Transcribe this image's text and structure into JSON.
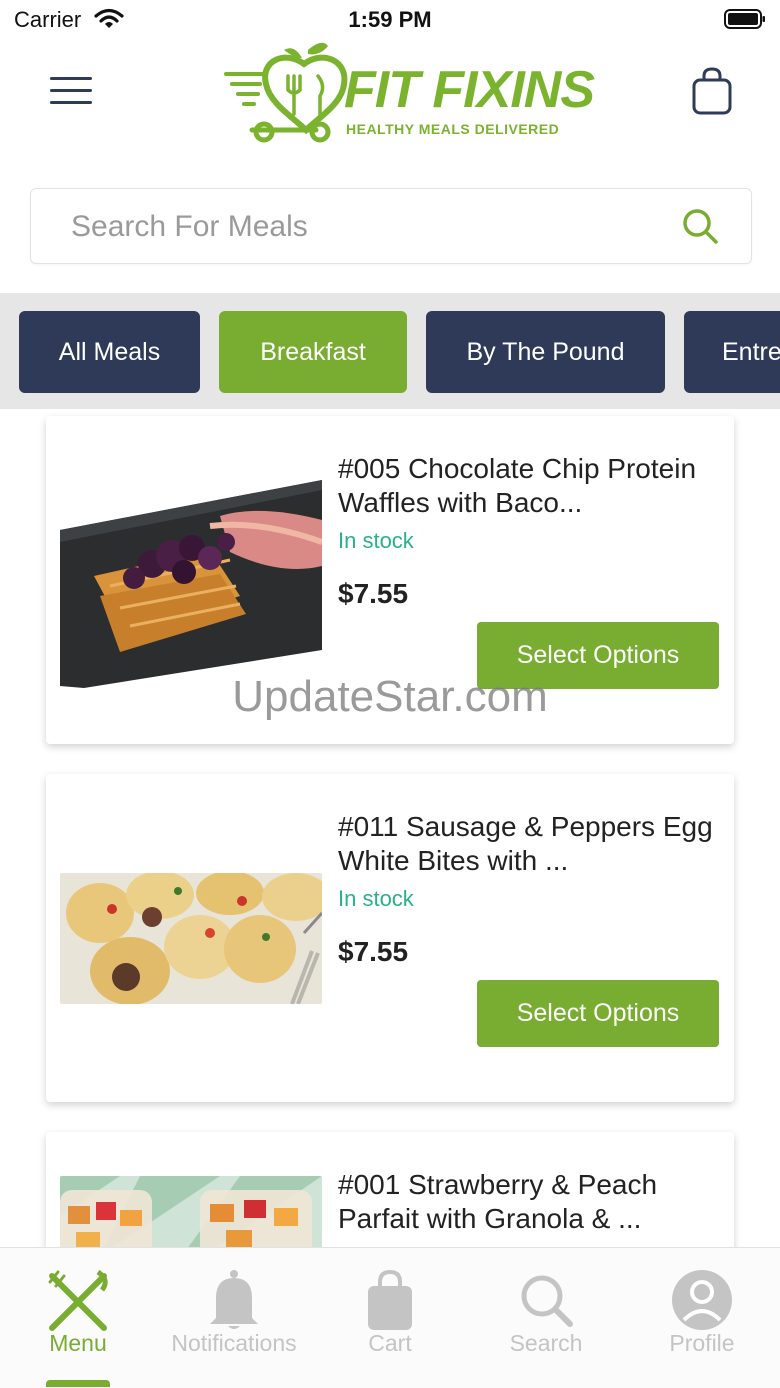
{
  "status_bar": {
    "carrier": "Carrier",
    "time": "1:59 PM"
  },
  "header": {
    "logo_title": "FIT FIXINS",
    "logo_subtitle": "HEALTHY MEALS DELIVERED",
    "brand_color": "#7bb32e"
  },
  "search": {
    "placeholder": "Search For Meals"
  },
  "categories": [
    {
      "label": "All Meals",
      "active": false
    },
    {
      "label": "Breakfast",
      "active": true
    },
    {
      "label": "By The Pound",
      "active": false
    },
    {
      "label": "Entre",
      "active": false
    }
  ],
  "products": [
    {
      "title": "#005  Chocolate Chip Protein Waffles with Baco...",
      "stock": "In stock",
      "price": "$7.55",
      "button": "Select Options",
      "image": "waffles-with-berries-and-bacon"
    },
    {
      "title": "#011  Sausage & Peppers Egg White Bites with ...",
      "stock": "In stock",
      "price": "$7.55",
      "button": "Select Options",
      "image": "egg-white-bites"
    },
    {
      "title": "#001 Strawberry & Peach Parfait with Granola & ...",
      "stock": "",
      "price": "",
      "button": "",
      "image": "fruit-parfait-cups"
    }
  ],
  "watermark": "UpdateStar.com",
  "tabbar": {
    "items": [
      {
        "label": "Menu",
        "icon": "fork-knife-icon",
        "active": true
      },
      {
        "label": "Notifications",
        "icon": "bell-icon",
        "active": false
      },
      {
        "label": "Cart",
        "icon": "bag-icon",
        "active": false
      },
      {
        "label": "Search",
        "icon": "search-icon",
        "active": false
      },
      {
        "label": "Profile",
        "icon": "profile-icon",
        "active": false
      }
    ]
  },
  "colors": {
    "accent_green": "#78ad31",
    "navy": "#2e3a58",
    "stock_teal": "#2ab08b",
    "inactive_gray": "#c4c4c4"
  }
}
